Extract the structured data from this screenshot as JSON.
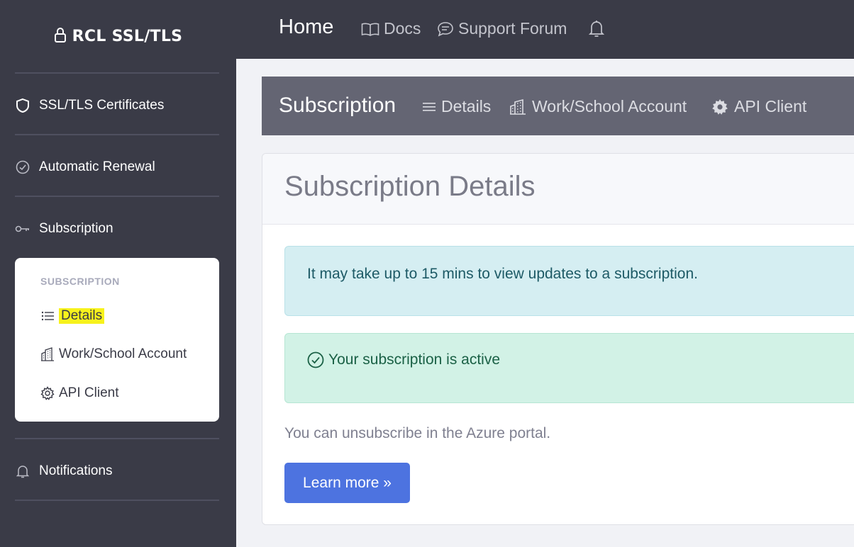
{
  "sidebar": {
    "brand": "RCL SSL/TLS",
    "items": [
      {
        "label": "SSL/TLS Certificates",
        "icon": "shield-icon"
      },
      {
        "label": "Automatic Renewal",
        "icon": "check-circle-icon"
      },
      {
        "label": "Subscription",
        "icon": "key-icon"
      },
      {
        "label": "Notifications",
        "icon": "bell-icon"
      }
    ],
    "submenu": {
      "header": "SUBSCRIPTION",
      "items": [
        {
          "label": "Details",
          "icon": "list-icon",
          "highlighted": true
        },
        {
          "label": "Work/School Account",
          "icon": "building-icon"
        },
        {
          "label": "API Client",
          "icon": "gear-icon"
        }
      ]
    }
  },
  "topbar": {
    "home": "Home",
    "links": [
      {
        "label": "Docs",
        "icon": "book-icon"
      },
      {
        "label": "Support Forum",
        "icon": "chat-icon"
      }
    ],
    "bell_icon": "bell-icon"
  },
  "subnav": {
    "title": "Subscription",
    "links": [
      {
        "label": "Details",
        "icon": "list-icon"
      },
      {
        "label": "Work/School Account",
        "icon": "building-icon"
      },
      {
        "label": "API Client",
        "icon": "gear-icon"
      }
    ]
  },
  "card": {
    "title": "Subscription Details",
    "info_alert": "It may take up to 15 mins to view updates to a subscription.",
    "success_alert": "Your subscription is active",
    "muted_text": "You can unsubscribe in the Azure portal.",
    "button_label": "Learn more »"
  },
  "colors": {
    "sidebar_bg": "#3a3b47",
    "subnav_bg": "#646573",
    "primary": "#4d73e0",
    "highlight": "#f7f21c"
  }
}
